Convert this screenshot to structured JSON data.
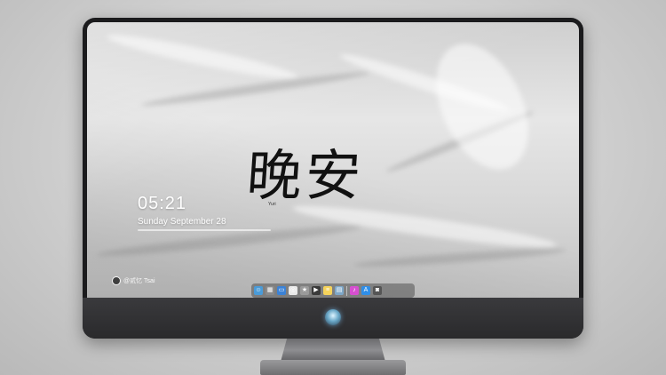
{
  "lockscreen": {
    "time": "05:21",
    "date": "Sunday September 28",
    "greeting": "晚安",
    "signature": "Yuri",
    "weibo_handle": "@贰忆 Tsai"
  },
  "dock": {
    "items": [
      {
        "name": "finder-icon",
        "color": "#4a9bd8",
        "glyph": "☺"
      },
      {
        "name": "launchpad-icon",
        "color": "#8b8b8b",
        "glyph": "▦"
      },
      {
        "name": "files-icon",
        "color": "#3b82d6",
        "glyph": "▭"
      },
      {
        "name": "safari-icon",
        "color": "#e9e9e9",
        "glyph": "◎"
      },
      {
        "name": "imovie-icon",
        "color": "#9a9a9a",
        "glyph": "★"
      },
      {
        "name": "final-cut-icon",
        "color": "#3a3a3a",
        "glyph": "▶"
      },
      {
        "name": "notes-icon",
        "color": "#f5d35b",
        "glyph": "≡"
      },
      {
        "name": "preview-icon",
        "color": "#7ea7c8",
        "glyph": "▤"
      },
      {
        "name": "itunes-icon",
        "color": "#d64fd0",
        "glyph": "♪"
      },
      {
        "name": "app-store-icon",
        "color": "#2f8ee8",
        "glyph": "A"
      },
      {
        "name": "camera-icon",
        "color": "#555555",
        "glyph": "◙"
      }
    ]
  }
}
